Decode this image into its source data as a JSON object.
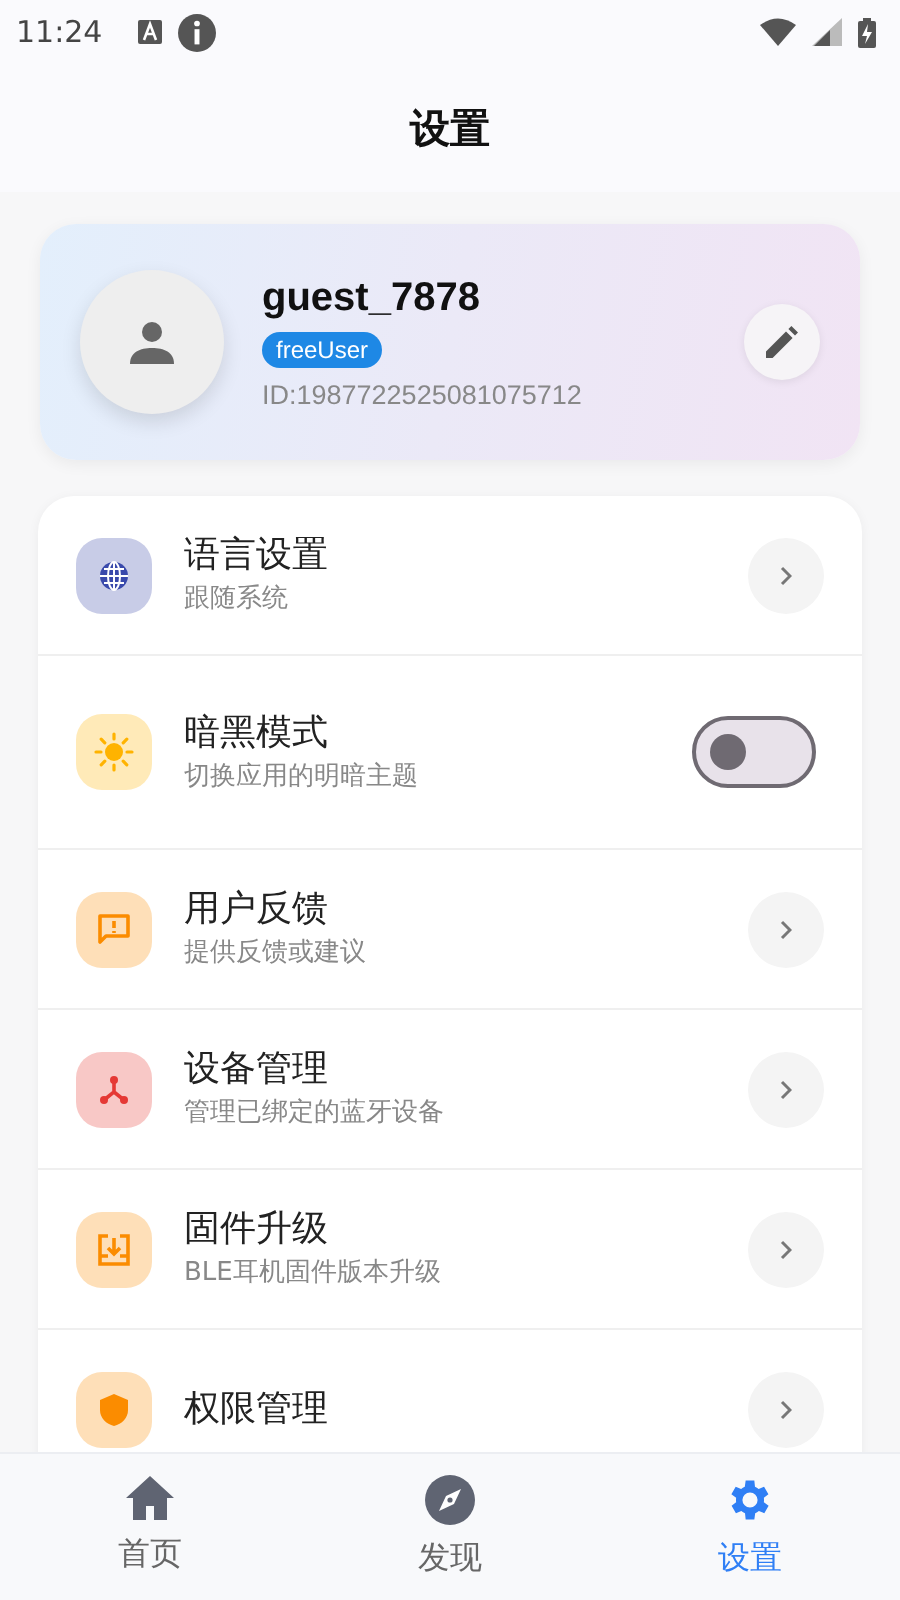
{
  "status_bar": {
    "time": "11:24"
  },
  "header": {
    "title": "设置"
  },
  "profile": {
    "username": "guest_7878",
    "badge": "freeUser",
    "user_id": "ID:1987722525081075712"
  },
  "settings": [
    {
      "kind": "link",
      "title": "语言设置",
      "subtitle": "跟随系统",
      "color": "#3949ab"
    },
    {
      "kind": "toggle",
      "title": "暗黑模式",
      "subtitle": "切换应用的明暗主题",
      "color": "#ffb300",
      "on": false
    },
    {
      "kind": "link",
      "title": "用户反馈",
      "subtitle": "提供反馈或建议",
      "color": "#fb8c00"
    },
    {
      "kind": "link",
      "title": "设备管理",
      "subtitle": "管理已绑定的蓝牙设备",
      "color": "#e53935"
    },
    {
      "kind": "link",
      "title": "固件升级",
      "subtitle": "BLE耳机固件版本升级",
      "color": "#fb8c00"
    },
    {
      "kind": "link",
      "title": "权限管理",
      "color": "#fb8c00"
    }
  ],
  "bottom_nav": [
    {
      "label": "首页",
      "selected": false
    },
    {
      "label": "发现",
      "selected": false
    },
    {
      "label": "设置",
      "selected": true
    }
  ]
}
